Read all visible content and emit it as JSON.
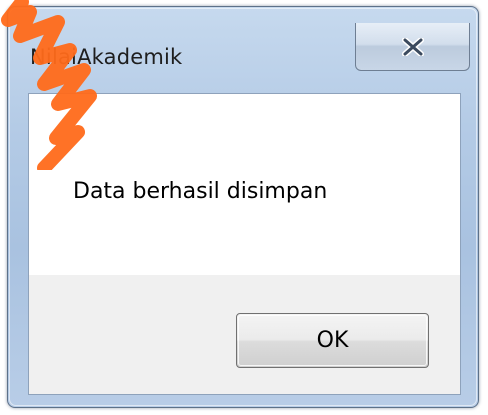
{
  "dialog": {
    "title": "NilaiAkademik",
    "message": "Data berhasil disimpan",
    "ok_label": "OK",
    "close_icon": "close-icon"
  },
  "colors": {
    "frame": "#b4cbe6",
    "client_bg": "#f0f0f0",
    "watermark": "#ff6a1a"
  }
}
